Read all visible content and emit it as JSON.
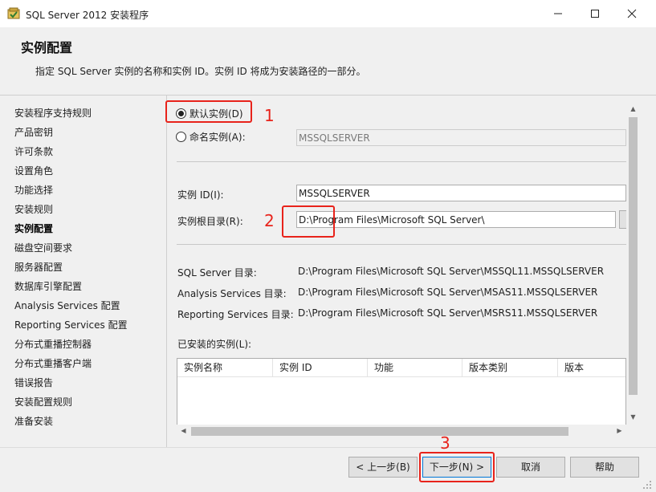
{
  "window": {
    "title": "SQL Server 2012 安装程序",
    "minimize_icon": "minimize-icon",
    "maximize_icon": "maximize-icon",
    "close_icon": "close-icon"
  },
  "header": {
    "title": "实例配置",
    "description": "指定 SQL Server 实例的名称和实例 ID。实例 ID 将成为安装路径的一部分。"
  },
  "nav": {
    "items": [
      {
        "label": "安装程序支持规则",
        "active": false
      },
      {
        "label": "产品密钥",
        "active": false
      },
      {
        "label": "许可条款",
        "active": false
      },
      {
        "label": "设置角色",
        "active": false
      },
      {
        "label": "功能选择",
        "active": false
      },
      {
        "label": "安装规则",
        "active": false
      },
      {
        "label": "实例配置",
        "active": true
      },
      {
        "label": "磁盘空间要求",
        "active": false
      },
      {
        "label": "服务器配置",
        "active": false
      },
      {
        "label": "数据库引擎配置",
        "active": false
      },
      {
        "label": "Analysis Services 配置",
        "active": false
      },
      {
        "label": "Reporting Services 配置",
        "active": false
      },
      {
        "label": "分布式重播控制器",
        "active": false
      },
      {
        "label": "分布式重播客户端",
        "active": false
      },
      {
        "label": "错误报告",
        "active": false
      },
      {
        "label": "安装配置规则",
        "active": false
      },
      {
        "label": "准备安装",
        "active": false
      }
    ]
  },
  "instance": {
    "default_radio_label": "默认实例(D)",
    "named_radio_label": "命名实例(A):",
    "selected": "default",
    "named_value": "MSSQLSERVER",
    "id_label": "实例 ID(I):",
    "id_value": "MSSQLSERVER",
    "root_label": "实例根目录(R):",
    "root_value": "D:\\Program Files\\Microsoft SQL Server\\"
  },
  "dirs": [
    {
      "label": "SQL Server 目录:",
      "value": "D:\\Program Files\\Microsoft SQL Server\\MSSQL11.MSSQLSERVER"
    },
    {
      "label": "Analysis Services 目录:",
      "value": "D:\\Program Files\\Microsoft SQL Server\\MSAS11.MSSQLSERVER"
    },
    {
      "label": "Reporting Services 目录:",
      "value": "D:\\Program Files\\Microsoft SQL Server\\MSRS11.MSSQLSERVER"
    }
  ],
  "installed": {
    "label": "已安装的实例(L):",
    "columns": [
      "实例名称",
      "实例 ID",
      "功能",
      "版本类别",
      "版本"
    ],
    "rows": []
  },
  "buttons": {
    "back": "< 上一步(B)",
    "next": "下一步(N) >",
    "cancel": "取消",
    "help": "帮助"
  },
  "annotations": [
    "1",
    "2",
    "3"
  ],
  "colors": {
    "annotation_red": "#e8231b",
    "primary_border": "#0078d7"
  }
}
